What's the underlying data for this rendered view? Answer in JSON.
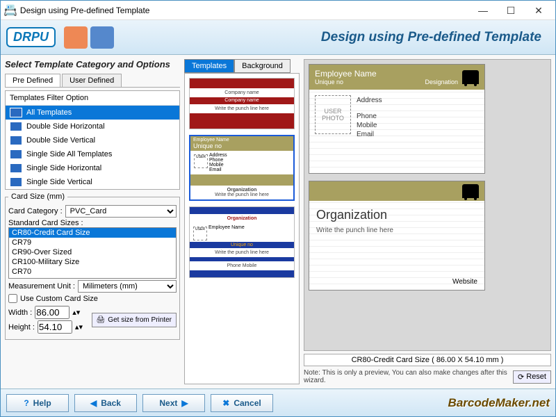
{
  "window": {
    "title": "Design using Pre-defined Template"
  },
  "header": {
    "logo": "DRPU",
    "title": "Design using Pre-defined Template"
  },
  "section_title": "Select Template Category and Options",
  "left_tabs": {
    "predefined": "Pre Defined",
    "userdefined": "User Defined"
  },
  "filter": {
    "heading": "Templates Filter Option",
    "items": [
      "All Templates",
      "Double Side Horizontal",
      "Double Side Vertical",
      "Single Side All Templates",
      "Single Side Horizontal",
      "Single Side Vertical"
    ]
  },
  "card_size": {
    "group": "Card Size (mm)",
    "category_label": "Card Category :",
    "category_value": "PVC_Card",
    "std_label": "Standard Card Sizes :",
    "sizes": [
      "CR80-Credit Card Size",
      "CR79",
      "CR90-Over Sized",
      "CR100-Military Size",
      "CR70"
    ],
    "unit_label": "Measurement Unit :",
    "unit_value": "Milimeters (mm)",
    "custom_label": "Use Custom Card Size",
    "width_label": "Width :",
    "width_value": "86.00",
    "height_label": "Height :",
    "height_value": "54.10",
    "printer_btn": "Get size from Printer"
  },
  "mid_tabs": {
    "templates": "Templates",
    "background": "Background"
  },
  "tpl1": {
    "company": "Company name",
    "company2": "Company name",
    "punch": "Write the punch line here"
  },
  "tpl2": {
    "emp": "Employee Name",
    "unique": "Unique no",
    "addr": "Address",
    "phone": "Phone",
    "mobile": "Mobile",
    "email": "Email",
    "org": "Organization",
    "punch": "Write the punch line here"
  },
  "tpl3": {
    "org": "Organization",
    "emp": "Employee Name",
    "unique": "Unique no",
    "punch": "Write the punch line here",
    "phone": "Phone",
    "mobile": "Mobile"
  },
  "preview": {
    "front": {
      "emp": "Employee Name",
      "unique": "Unique no",
      "designation": "Designation",
      "photo": "USER PHOTO",
      "address": "Address",
      "phone": "Phone",
      "mobile": "Mobile",
      "email": "Email"
    },
    "back": {
      "org": "Organization",
      "punch": "Write the punch line here",
      "website": "Website"
    },
    "size_text": "CR80-Credit Card Size ( 86.00 X 54.10 mm )",
    "note": "Note: This is only a preview, You can also make changes after this wizard.",
    "reset": "Reset"
  },
  "footer": {
    "help": "Help",
    "back": "Back",
    "next": "Next",
    "cancel": "Cancel",
    "brand": "BarcodeMaker.net"
  }
}
